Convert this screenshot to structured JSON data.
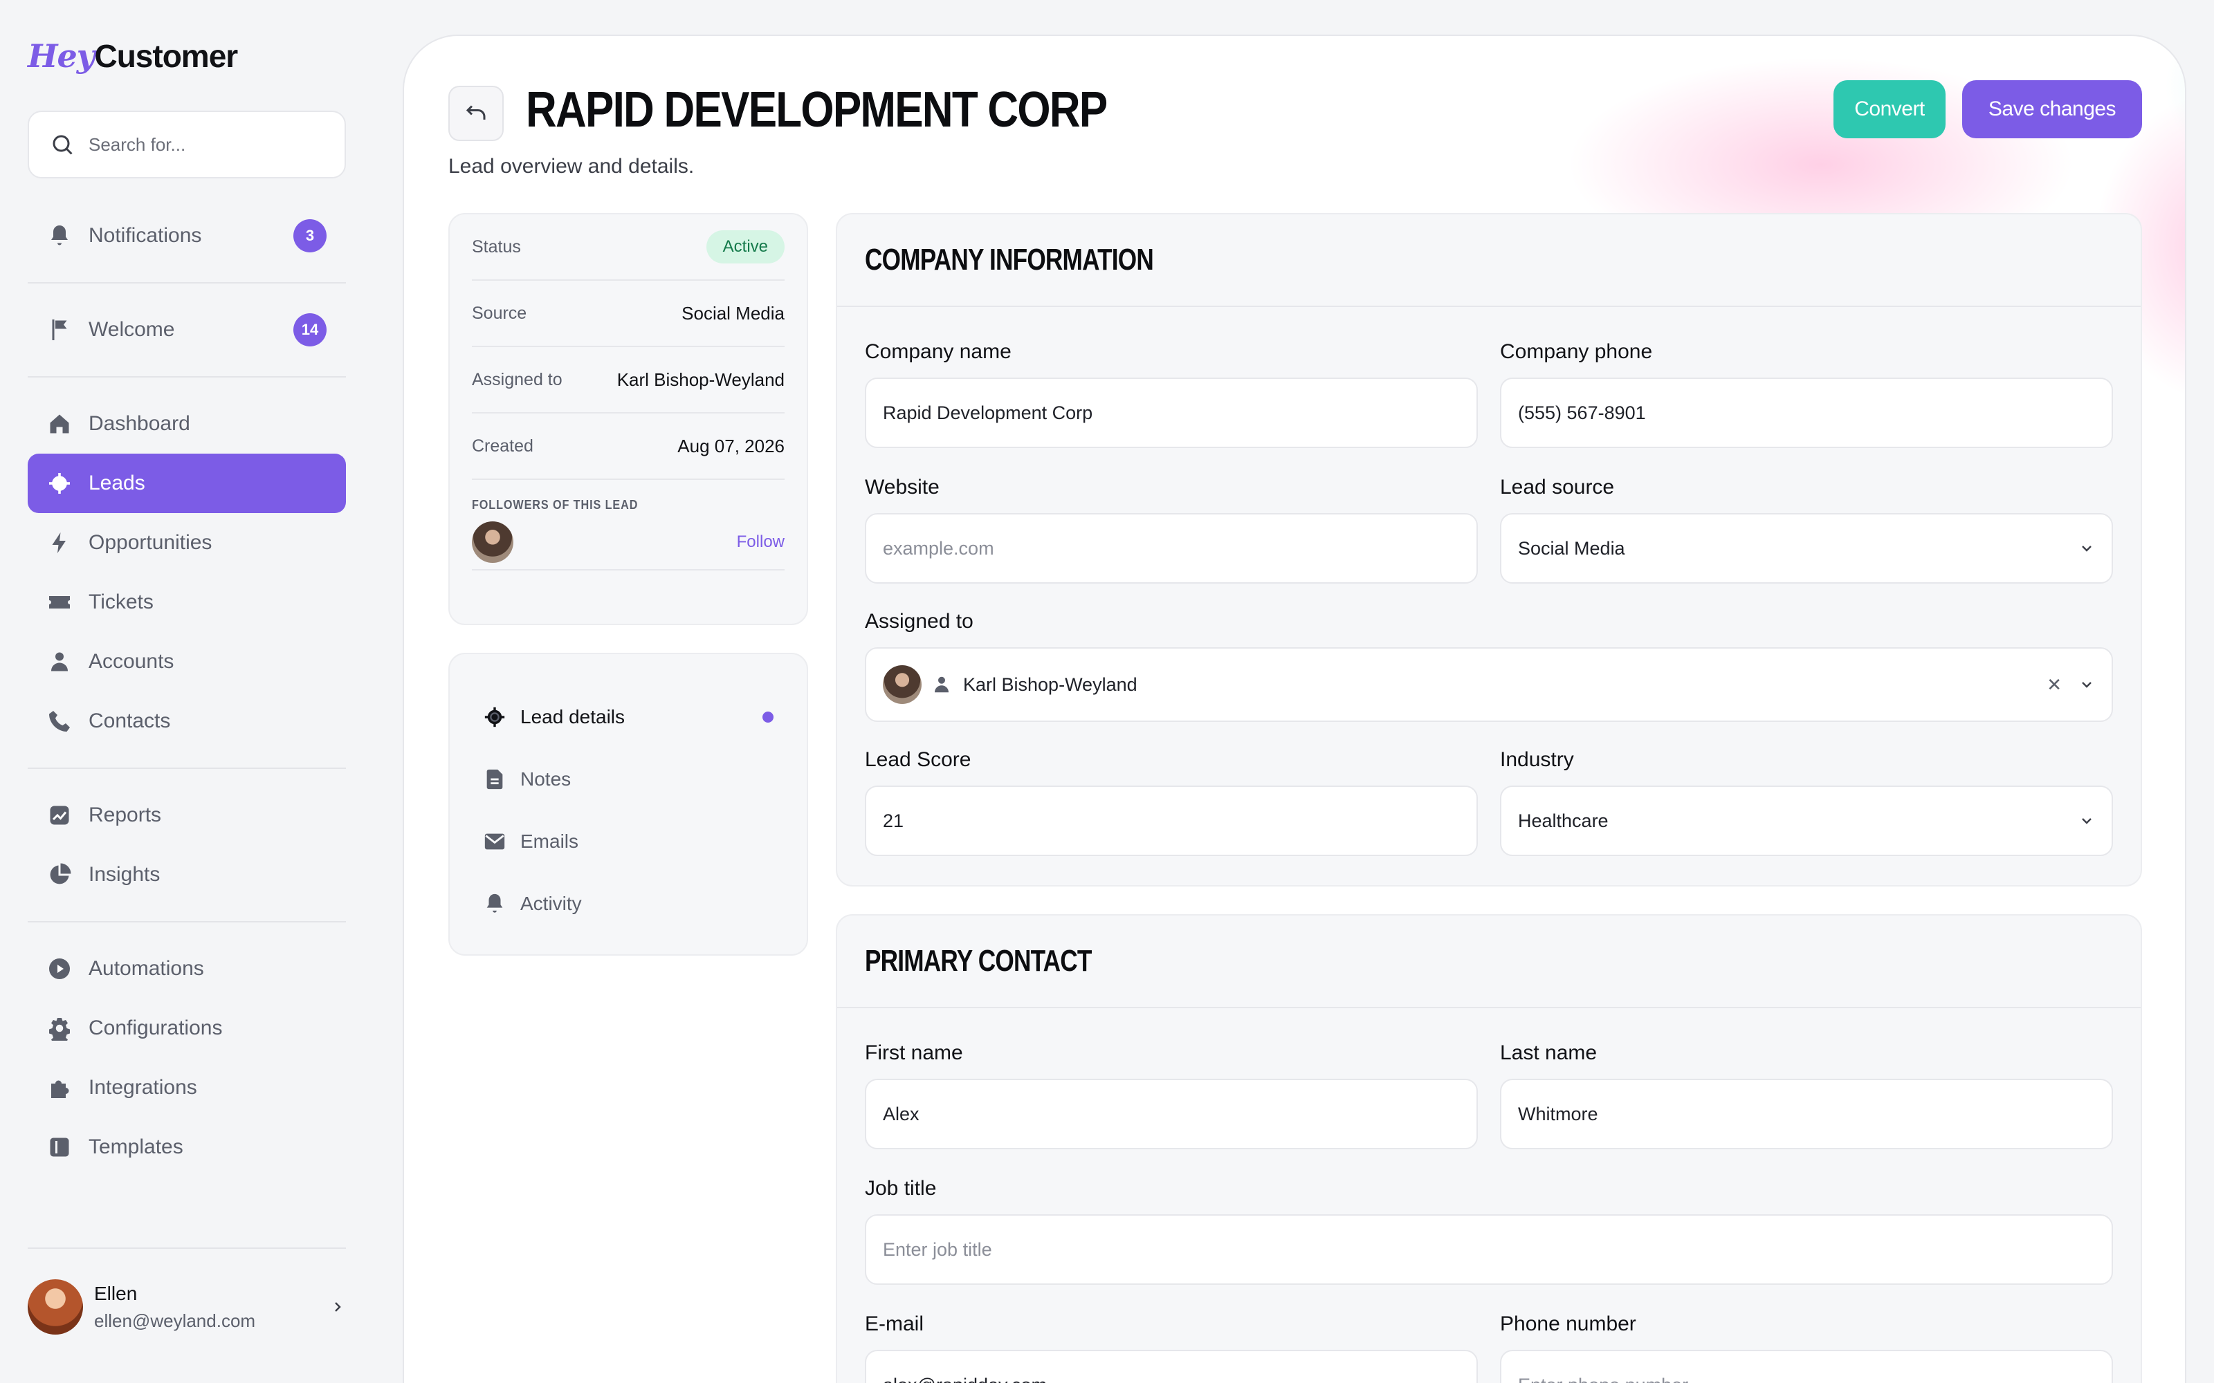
{
  "app": {
    "logo_hey": "Hey",
    "logo_customer": "Customer"
  },
  "search": {
    "placeholder": "Search for..."
  },
  "nav": {
    "notifications": {
      "label": "Notifications",
      "badge": "3"
    },
    "welcome": {
      "label": "Welcome",
      "badge": "14"
    },
    "dashboard": "Dashboard",
    "leads": "Leads",
    "opportunities": "Opportunities",
    "tickets": "Tickets",
    "accounts": "Accounts",
    "contacts": "Contacts",
    "reports": "Reports",
    "insights": "Insights",
    "automations": "Automations",
    "configurations": "Configurations",
    "integrations": "Integrations",
    "templates": "Templates"
  },
  "user": {
    "name": "Ellen",
    "email": "ellen@weyland.com"
  },
  "page": {
    "title": "RAPID DEVELOPMENT CORP",
    "subtitle": "Lead overview and details.",
    "convert_label": "Convert",
    "save_label": "Save changes"
  },
  "summary": {
    "status_label": "Status",
    "status_value": "Active",
    "source_label": "Source",
    "source_value": "Social Media",
    "assigned_label": "Assigned to",
    "assigned_value": "Karl Bishop-Weyland",
    "created_label": "Created",
    "created_value": "Aug 07, 2026",
    "followers_title": "FOLLOWERS OF THIS LEAD",
    "follow_label": "Follow"
  },
  "menu": {
    "lead_details": "Lead details",
    "notes": "Notes",
    "emails": "Emails",
    "activity": "Activity"
  },
  "company": {
    "title": "COMPANY INFORMATION",
    "name_label": "Company name",
    "name_value": "Rapid Development Corp",
    "phone_label": "Company phone",
    "phone_value": "(555) 567-8901",
    "website_label": "Website",
    "website_placeholder": "example.com",
    "source_label": "Lead source",
    "source_value": "Social Media",
    "assigned_label": "Assigned to",
    "assigned_value": "Karl Bishop-Weyland",
    "score_label": "Lead Score",
    "score_value": "21",
    "industry_label": "Industry",
    "industry_value": "Healthcare"
  },
  "contact": {
    "title": "PRIMARY CONTACT",
    "first_label": "First name",
    "first_value": "Alex",
    "last_label": "Last name",
    "last_value": "Whitmore",
    "job_label": "Job title",
    "job_placeholder": "Enter job title",
    "email_label": "E-mail",
    "email_value": "alex@rapiddev.com",
    "phone_label": "Phone number",
    "phone_placeholder": "Enter phone number"
  },
  "colors": {
    "accent": "#7c5ce6",
    "teal": "#2ec8b0",
    "active_pill": "#d6f5e5"
  }
}
